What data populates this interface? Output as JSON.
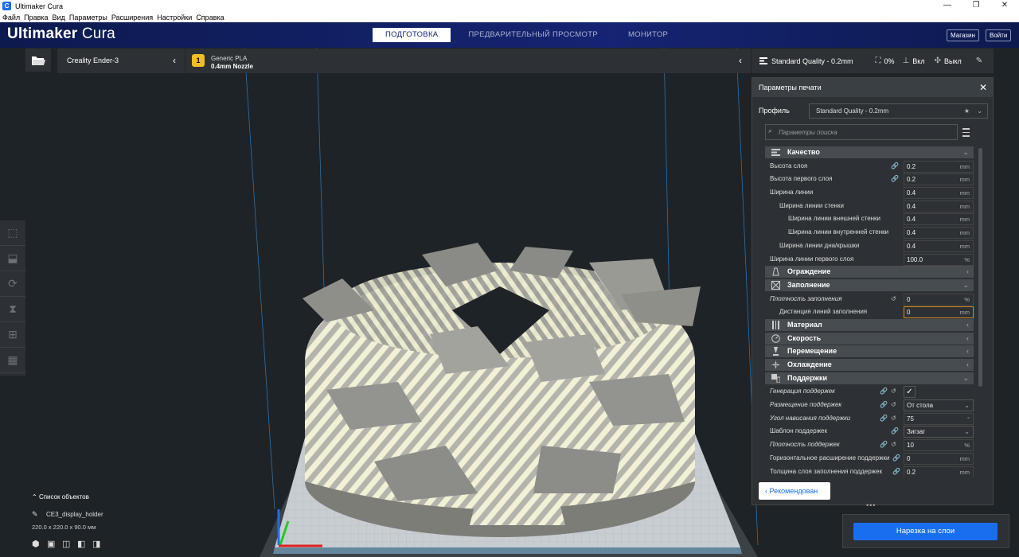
{
  "window": {
    "title": "Ultimaker Cura",
    "minimize": "—",
    "restore": "❐",
    "close": "✕"
  },
  "menu": [
    "Файл",
    "Правка",
    "Вид",
    "Параметры",
    "Расширения",
    "Настройки",
    "Справка"
  ],
  "header": {
    "brand_bold": "Ultimaker",
    "brand_light": " Cura",
    "tabs": [
      "ПОДГОТОВКА",
      "ПРЕДВАРИТЕЛЬНЫЙ ПРОСМОТР",
      "МОНИТОР"
    ],
    "active_tab": 0,
    "marketplace": "Магазин",
    "signin": "Войти"
  },
  "printer": {
    "name": "Creality Ender-3"
  },
  "material": {
    "name": "Generic PLA",
    "nozzle": "0.4mm Nozzle",
    "badge": "1"
  },
  "quality": {
    "profile": "Standard Quality - 0.2mm",
    "infill": "0%",
    "support": "Вкл",
    "adhesion": "Выкл"
  },
  "panel": {
    "title": "Параметры печати",
    "profile_label": "Профиль",
    "profile_value": "Standard Quality - 0.2mm",
    "search_placeholder": "Параметры поиска",
    "recommended": "Рекомендован",
    "categories": {
      "quality": "Качество",
      "walls": "Ограждение",
      "infill": "Заполнение",
      "material": "Материал",
      "speed": "Скорость",
      "travel": "Перемещение",
      "cooling": "Охлаждение",
      "support": "Поддержки"
    },
    "quality_rows": [
      {
        "label": "Высота слоя",
        "value": "0.2",
        "unit": "mm"
      },
      {
        "label": "Высота первого слоя",
        "value": "0.2",
        "unit": "mm"
      },
      {
        "label": "Ширина линии",
        "value": "0.4",
        "unit": "mm"
      },
      {
        "label": "Ширина линии стенки",
        "value": "0.4",
        "unit": "mm"
      },
      {
        "label": "Ширина линии внешней стенки",
        "value": "0.4",
        "unit": "mm"
      },
      {
        "label": "Ширина линии внутренней стенки",
        "value": "0.4",
        "unit": "mm"
      },
      {
        "label": "Ширина линии дна/крышки",
        "value": "0.4",
        "unit": "mm"
      },
      {
        "label": "Ширина линии первого слоя",
        "value": "100.0",
        "unit": "%"
      }
    ],
    "infill_rows": [
      {
        "label": "Плотность заполнения",
        "value": "0",
        "unit": "%"
      },
      {
        "label": "Дистанция линий заполнения",
        "value": "0",
        "unit": "mm"
      }
    ],
    "support_rows": [
      {
        "label": "Генерация поддержек",
        "value": "✓"
      },
      {
        "label": "Размещение поддержек",
        "value": "От стола"
      },
      {
        "label": "Угол нависания поддержки",
        "value": "75",
        "unit": "°"
      },
      {
        "label": "Шаблон поддержек",
        "value": "Зигзаг"
      },
      {
        "label": "Плотность поддержек",
        "value": "10",
        "unit": "%"
      },
      {
        "label": "Горизонтальное расширение поддержки",
        "value": "0",
        "unit": "mm"
      },
      {
        "label": "Толщина слоя заполнения поддержек",
        "value": "0.2",
        "unit": "mm"
      }
    ]
  },
  "slice_button": "Нарезка на слои",
  "objects": {
    "header": "Список объектов",
    "name": "CE3_display_holder",
    "dims": "220.0 x 220.0 x 90.0 мм"
  },
  "icons": {
    "open": "folder-icon",
    "colors": {
      "accent": "#196ef0",
      "header": "#152473",
      "panel": "#2d3135",
      "material": "#f1bf24"
    }
  }
}
